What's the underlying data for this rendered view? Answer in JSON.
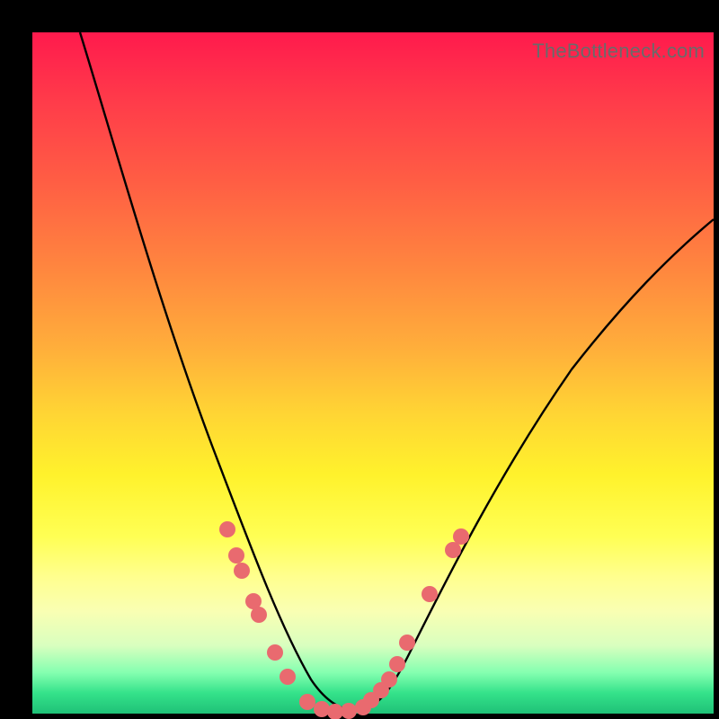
{
  "attribution": "TheBottleneck.com",
  "colors": {
    "frame": "#000000",
    "curve": "#000000",
    "dots": "#e96a6f",
    "gradient_top": "#ff1a4d",
    "gradient_bottom": "#1fc177"
  },
  "chart_data": {
    "type": "line",
    "title": "",
    "xlabel": "",
    "ylabel": "",
    "xlim": [
      0,
      100
    ],
    "ylim": [
      0,
      100
    ],
    "series": [
      {
        "name": "bottleneck-curve",
        "x": [
          7,
          12,
          18,
          24,
          28,
          32,
          35,
          38,
          40,
          42,
          44,
          46,
          48,
          50,
          52,
          55,
          60,
          65,
          70,
          78,
          88,
          100
        ],
        "y": [
          100,
          82,
          64,
          50,
          40,
          31,
          24,
          16,
          10,
          5,
          2,
          0,
          0,
          1,
          4,
          10,
          20,
          30,
          40,
          52,
          63,
          73
        ]
      }
    ],
    "dots": [
      {
        "x": 28.6,
        "y": 27.0
      },
      {
        "x": 30.0,
        "y": 23.2
      },
      {
        "x": 30.7,
        "y": 21.0
      },
      {
        "x": 32.5,
        "y": 16.5
      },
      {
        "x": 33.2,
        "y": 14.5
      },
      {
        "x": 35.6,
        "y": 9.0
      },
      {
        "x": 37.5,
        "y": 5.4
      },
      {
        "x": 40.4,
        "y": 1.7
      },
      {
        "x": 42.5,
        "y": 0.6
      },
      {
        "x": 44.5,
        "y": 0.3
      },
      {
        "x": 46.5,
        "y": 0.4
      },
      {
        "x": 48.5,
        "y": 0.9
      },
      {
        "x": 49.7,
        "y": 2.0
      },
      {
        "x": 51.2,
        "y": 3.4
      },
      {
        "x": 52.4,
        "y": 5.0
      },
      {
        "x": 53.6,
        "y": 7.3
      },
      {
        "x": 55.0,
        "y": 10.4
      },
      {
        "x": 58.3,
        "y": 17.5
      },
      {
        "x": 61.8,
        "y": 24.0
      },
      {
        "x": 62.9,
        "y": 26.0
      }
    ]
  }
}
